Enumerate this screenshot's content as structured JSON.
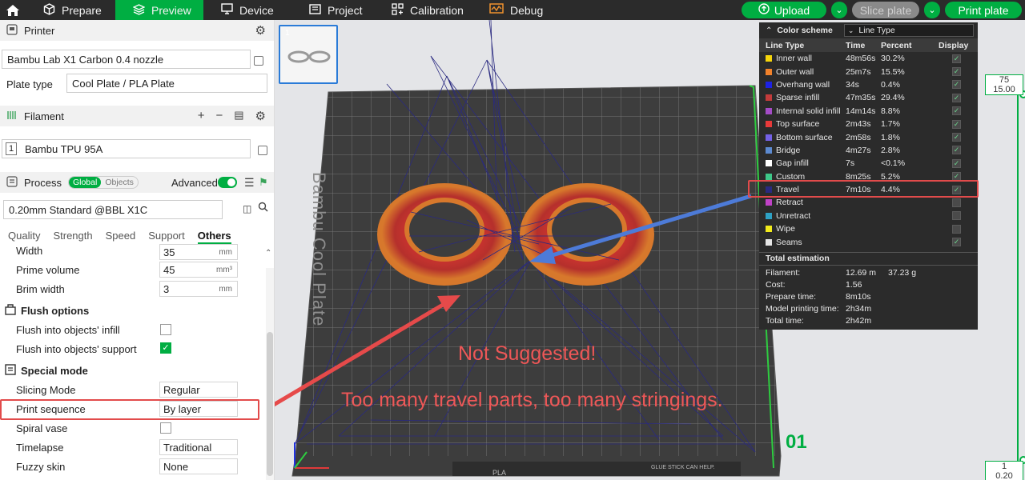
{
  "nav": {
    "tabs": [
      {
        "label": "Prepare",
        "icon": "cube-icon"
      },
      {
        "label": "Preview",
        "icon": "layers-icon"
      },
      {
        "label": "Device",
        "icon": "monitor-icon"
      },
      {
        "label": "Project",
        "icon": "folder-icon"
      },
      {
        "label": "Calibration",
        "icon": "calibration-icon"
      },
      {
        "label": "Debug",
        "icon": "debug-icon"
      }
    ],
    "upload_label": "Upload",
    "slice_label": "Slice plate",
    "print_label": "Print plate"
  },
  "printer": {
    "header": "Printer",
    "name": "Bambu Lab X1 Carbon 0.4 nozzle",
    "plate_type_label": "Plate type",
    "plate_type_value": "Cool Plate / PLA Plate"
  },
  "filament": {
    "header": "Filament",
    "slot": "1",
    "name": "Bambu TPU 95A"
  },
  "process": {
    "header": "Process",
    "global": "Global",
    "objects": "Objects",
    "advanced": "Advanced",
    "preset": "0.20mm Standard @BBL X1C",
    "tabs": [
      "Quality",
      "Strength",
      "Speed",
      "Support",
      "Others"
    ]
  },
  "settings": {
    "width_label": "Width",
    "width_value": "35",
    "width_unit": "mm",
    "prime_label": "Prime volume",
    "prime_value": "45",
    "prime_unit": "mm³",
    "brim_label": "Brim width",
    "brim_value": "3",
    "brim_unit": "mm",
    "flush_header": "Flush options",
    "flush_infill": "Flush into objects' infill",
    "flush_support": "Flush into objects' support",
    "special_header": "Special mode",
    "slicing_mode_label": "Slicing Mode",
    "slicing_mode_value": "Regular",
    "print_seq_label": "Print sequence",
    "print_seq_value": "By layer",
    "spiral_label": "Spiral vase",
    "timelapse_label": "Timelapse",
    "timelapse_value": "Traditional",
    "fuzzy_label": "Fuzzy skin",
    "fuzzy_value": "None"
  },
  "plate": {
    "label": "Bambu Cool Plate",
    "number": "01",
    "thumb_index": "1",
    "bottom_text": "PLA",
    "glue_text": "GLUE STICK CAN HELP."
  },
  "legend": {
    "title": "Color scheme",
    "scheme": "Line Type",
    "col_type": "Line Type",
    "col_time": "Time",
    "col_percent": "Percent",
    "col_display": "Display",
    "rows": [
      {
        "name": "Inner wall",
        "time": "48m56s",
        "percent": "30.2%",
        "color": "#f5d50b",
        "on": true
      },
      {
        "name": "Outer wall",
        "time": "25m7s",
        "percent": "15.5%",
        "color": "#f2822b",
        "on": true
      },
      {
        "name": "Overhang wall",
        "time": "34s",
        "percent": "0.4%",
        "color": "#1d22e4",
        "on": true
      },
      {
        "name": "Sparse infill",
        "time": "47m35s",
        "percent": "29.4%",
        "color": "#c33b3b",
        "on": true
      },
      {
        "name": "Internal solid infill",
        "time": "14m14s",
        "percent": "8.8%",
        "color": "#a44cc6",
        "on": true
      },
      {
        "name": "Top surface",
        "time": "2m43s",
        "percent": "1.7%",
        "color": "#e83a3a",
        "on": true
      },
      {
        "name": "Bottom surface",
        "time": "2m58s",
        "percent": "1.8%",
        "color": "#7461e6",
        "on": true
      },
      {
        "name": "Bridge",
        "time": "4m27s",
        "percent": "2.8%",
        "color": "#5c8ad0",
        "on": true
      },
      {
        "name": "Gap infill",
        "time": "7s",
        "percent": "<0.1%",
        "color": "#ffffff",
        "on": true
      },
      {
        "name": "Custom",
        "time": "8m25s",
        "percent": "5.2%",
        "color": "#3ec789",
        "on": true
      },
      {
        "name": "Travel",
        "time": "7m10s",
        "percent": "4.4%",
        "color": "#2a2a80",
        "on": true
      },
      {
        "name": "Retract",
        "time": "",
        "percent": "",
        "color": "#c042c7",
        "on": false
      },
      {
        "name": "Unretract",
        "time": "",
        "percent": "",
        "color": "#2ea1c4",
        "on": false
      },
      {
        "name": "Wipe",
        "time": "",
        "percent": "",
        "color": "#f1ea1c",
        "on": false
      },
      {
        "name": "Seams",
        "time": "",
        "percent": "",
        "color": "#e6e6e6",
        "on": true
      }
    ],
    "total_header": "Total estimation",
    "summary": [
      {
        "k": "Filament:",
        "v1": "12.69 m",
        "v2": "37.23 g"
      },
      {
        "k": "Cost:",
        "v1": "1.56",
        "v2": ""
      },
      {
        "k": "Prepare time:",
        "v1": "8m10s",
        "v2": ""
      },
      {
        "k": "Model printing time:",
        "v1": "2h34m",
        "v2": ""
      },
      {
        "k": "Total time:",
        "v1": "2h42m",
        "v2": ""
      }
    ]
  },
  "annotation": {
    "line1": "Not Suggested!",
    "line2": "Too many travel parts, too many stringings."
  },
  "layer_slider": {
    "top_layer": "75",
    "top_height": "15.00",
    "bottom_layer": "1",
    "bottom_height": "0.20"
  },
  "colors": {
    "accent": "#00ae42",
    "annotation_red": "#ee5757",
    "part_orange": "#d7782c",
    "top_red": "#c8332f",
    "travel": "#2a2a80"
  }
}
